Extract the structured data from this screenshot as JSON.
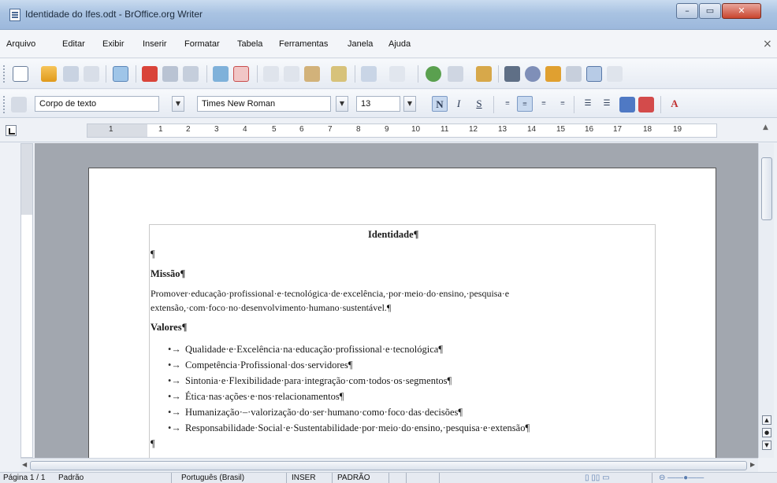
{
  "window": {
    "title": "Identidade do Ifes.odt - BrOffice.org Writer",
    "min_label": "–",
    "max_label": "▭",
    "close_label": "✕"
  },
  "menubar": {
    "items": [
      "Arquivo",
      "Editar",
      "Exibir",
      "Inserir",
      "Formatar",
      "Tabela",
      "Ferramentas",
      "Janela",
      "Ajuda"
    ],
    "close_label": "×"
  },
  "formatting": {
    "style": "Corpo de texto",
    "font": "Times New Roman",
    "size": "13",
    "bold": "N",
    "italic": "I",
    "underline": "S"
  },
  "ruler": {
    "labels": [
      "1",
      "1",
      "2",
      "3",
      "4",
      "5",
      "6",
      "7",
      "8",
      "9",
      "10",
      "11",
      "12",
      "13",
      "14",
      "15",
      "16",
      "17",
      "18",
      "19"
    ]
  },
  "document": {
    "heading": "Identidade¶",
    "empty_para": "¶",
    "missao_title": "Missão¶",
    "missao_line1": "Promover·educação·profissional·e·tecnológica·de·excelência,·por·meio·do·ensino,·pesquisa·e",
    "missao_line2": "extensão,·com·foco·no·desenvolvimento·humano·sustentável.¶",
    "valores_title": "Valores¶",
    "valores": [
      "Qualidade·e·Excelência·na·educação·profissional·e·tecnológica¶",
      "Competência·Profissional·dos·servidores¶",
      "Sintonia·e·Flexibilidade·para·integração·com·todos·os·segmentos¶",
      "Ética·nas·ações·e·nos·relacionamentos¶",
      "Humanização·–·valorização·do·ser·humano·como·foco·das·decisões¶",
      "Responsabilidade·Social·e·Sustentabilidade·por·meio·do·ensino,·pesquisa·e·extensão¶"
    ],
    "bullet": "•→"
  },
  "statusbar": {
    "page": "Página 1 / 1",
    "page_style": "Padrão",
    "language": "Português (Brasil)",
    "insert_mode": "INSER",
    "selection_mode": "PADRÃO"
  }
}
